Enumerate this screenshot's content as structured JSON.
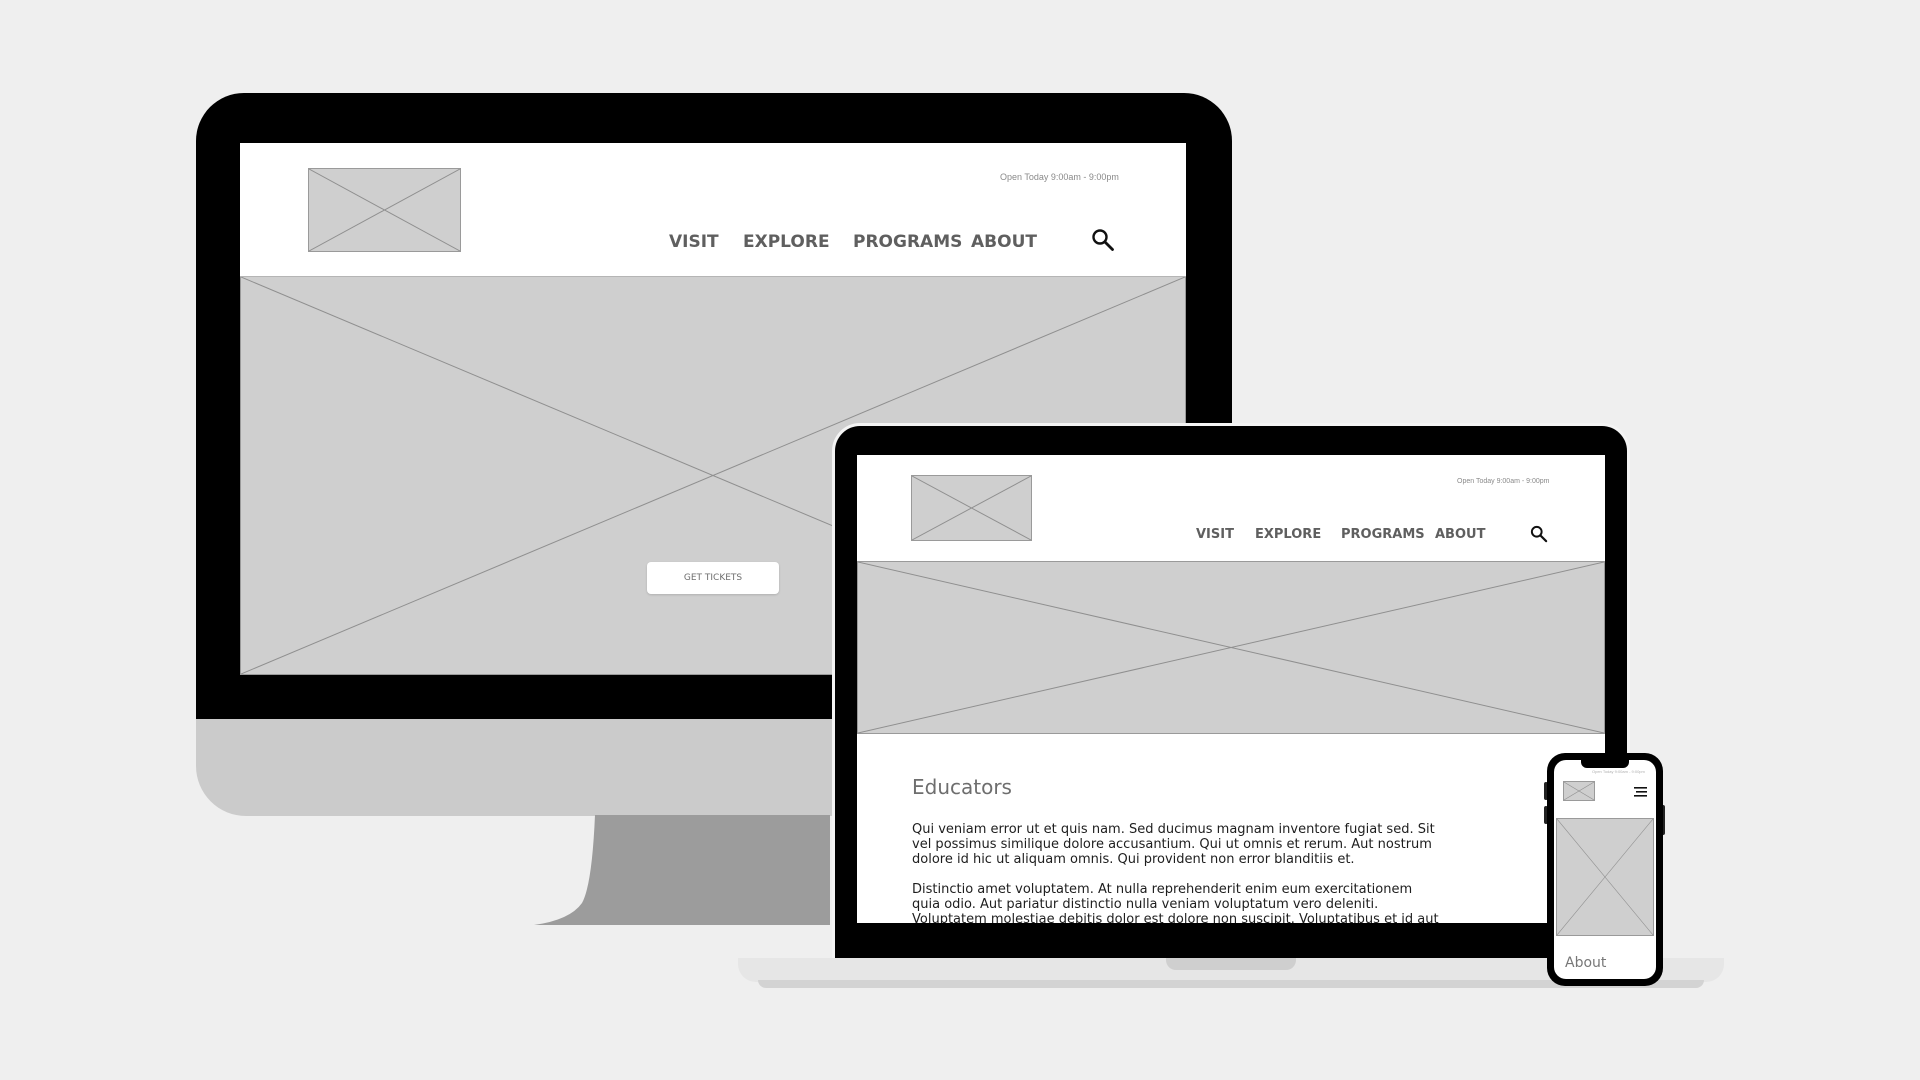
{
  "desktop": {
    "hours": "Open Today 9:00am - 9:00pm",
    "nav": [
      "VISIT",
      "EXPLORE",
      "PROGRAMS",
      "ABOUT"
    ],
    "cta_label": "GET TICKETS",
    "icons": {
      "search": "search-icon",
      "logo": "logo-image-placeholder",
      "hero": "hero-image-placeholder"
    }
  },
  "laptop": {
    "hours": "Open Today 9:00am - 9:00pm",
    "nav": [
      "VISIT",
      "EXPLORE",
      "PROGRAMS",
      "ABOUT"
    ],
    "section_title": "Educators",
    "paragraphs": [
      "Qui veniam error ut et quis nam. Sed ducimus magnam inventore fugiat sed. Sit vel possimus similique dolore accusantium. Qui ut omnis et rerum. Aut nostrum dolore id hic ut aliquam omnis. Qui provident non error blanditiis et.",
      "Distinctio amet voluptatem. At nulla reprehenderit enim eum exercitationem quia odio. Aut pariatur distinctio nulla veniam voluptatum vero deleniti. Voluptatem molestiae debitis dolor est dolore non suscipit. Voluptatibus et id aut eius."
    ],
    "icons": {
      "search": "search-icon"
    }
  },
  "phone": {
    "hours": "Open Today 9:00am - 9:00pm",
    "about_label": "About",
    "icons": {
      "menu": "hamburger-menu-icon"
    }
  },
  "colors": {
    "background": "#efefef",
    "device_frame": "#000000",
    "placeholder": "#cfcfcf",
    "nav_text": "#5f5f5f"
  }
}
